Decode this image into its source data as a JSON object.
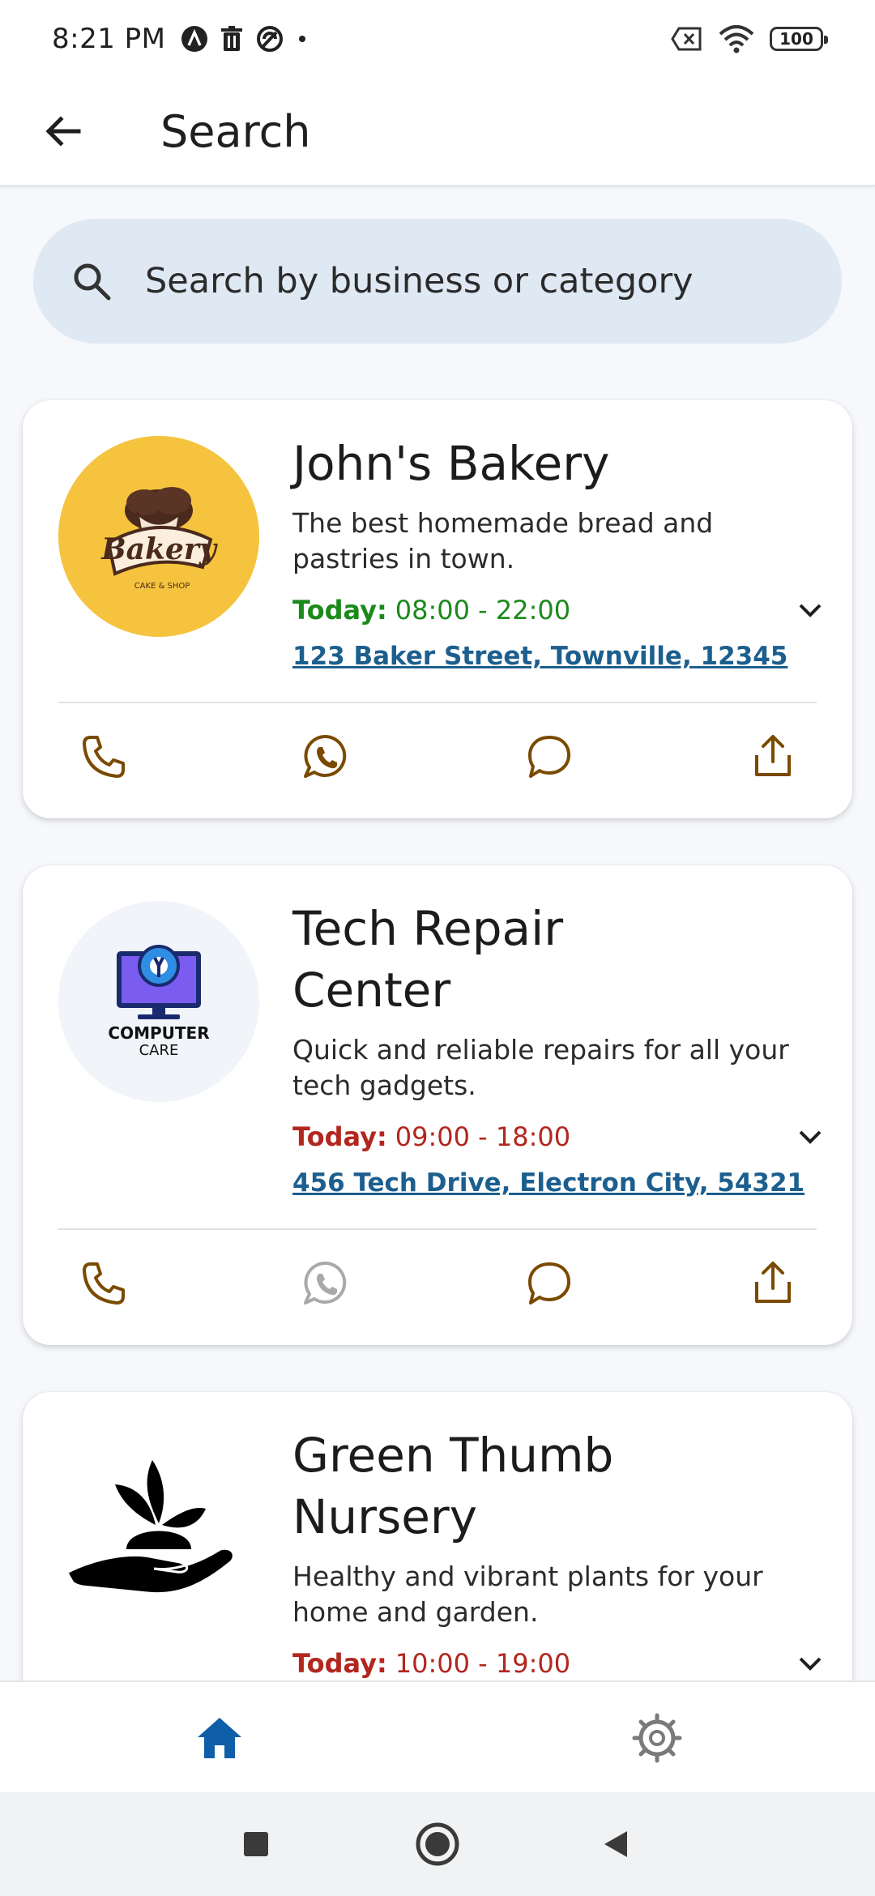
{
  "status_bar": {
    "time": "8:21 PM",
    "battery": "100"
  },
  "app_bar": {
    "title": "Search"
  },
  "search": {
    "placeholder": "Search by business or category"
  },
  "colors": {
    "accent": "#7a4a00",
    "open_green": "#1b8a1b",
    "closed_red": "#b3261e",
    "link_blue": "#1c5f8e",
    "nav_selected": "#0f5ea8"
  },
  "businesses": [
    {
      "name": "John's Bakery",
      "description": "The best homemade bread and pastries in town.",
      "hours_label": "Today:",
      "hours": "08:00 - 22:00",
      "hours_status": "open",
      "address": "123 Baker Street, Townville, 12345",
      "logo": "bakery-logo",
      "logo_text": "Bakery",
      "logo_subtext": "CAKE & SHOP",
      "whatsapp_enabled": true
    },
    {
      "name": "Tech Repair Center",
      "description": "Quick and reliable repairs for all your tech gadgets.",
      "hours_label": "Today:",
      "hours": "09:00 - 18:00",
      "hours_status": "closed",
      "address": "456 Tech Drive, Electron City, 54321",
      "logo": "computer-care-logo",
      "logo_text": "COMPUTER",
      "logo_subtext": "CARE",
      "whatsapp_enabled": false
    },
    {
      "name": "Green Thumb Nursery",
      "description": "Healthy and vibrant plants for your home and garden.",
      "hours_label": "Today:",
      "hours": "10:00 - 19:00",
      "hours_status": "closed",
      "logo": "plant-in-hand-logo"
    }
  ],
  "bottom_nav": {
    "items": [
      "home-icon",
      "settings-icon"
    ],
    "selected": "home"
  }
}
